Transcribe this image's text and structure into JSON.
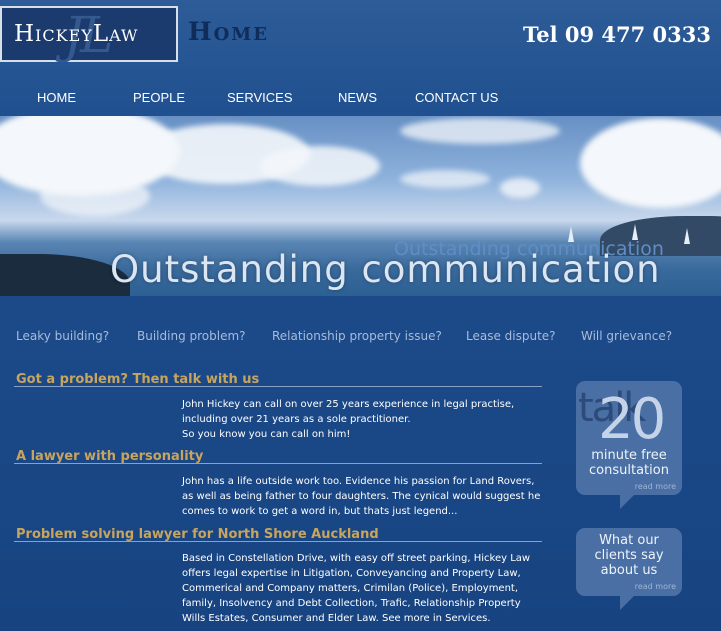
{
  "header": {
    "logo_text": "HickeyLaw",
    "logo_monogram": "JL",
    "page_title": "Home",
    "phone": "Tel 09 477 0333"
  },
  "nav": {
    "items": [
      {
        "label": "HOME"
      },
      {
        "label": "PEOPLE"
      },
      {
        "label": "SERVICES"
      },
      {
        "label": "NEWS"
      },
      {
        "label": "CONTACT US"
      }
    ]
  },
  "hero": {
    "tagline": "Outstanding communication",
    "tagline_echo": "Outstanding communication"
  },
  "topics": [
    {
      "label": "Leaky building?"
    },
    {
      "label": "Building problem?"
    },
    {
      "label": "Relationship property issue?"
    },
    {
      "label": "Lease dispute?"
    },
    {
      "label": "Will grievance?"
    }
  ],
  "sections": [
    {
      "heading": "Got a problem? Then talk with us",
      "paragraphs": [
        "John Hickey can call on over 25 years experience in legal practise, including over 21 years as a sole practitioner.",
        "So you know you can call on him!"
      ]
    },
    {
      "heading": "A lawyer with personality",
      "paragraphs": [
        "John has a life outside work too. Evidence his passion for Land Rovers, as well as being father to four daughters. The cynical would suggest he comes to work to get a word in, but thats just legend..."
      ]
    },
    {
      "heading": "Problem solving lawyer for North Shore Auckland",
      "paragraphs": [
        "Based in Constellation Drive, with easy off street parking, Hickey Law offers legal expertise in Litigation, Conveyancing and Property Law, Commerical and Company matters, Crimilan (Police), Employment, family, Insolvency and Debt Collection, Trafic, Relationship Property Wills Estates, Consumer and Elder Law. See more in Services."
      ]
    }
  ],
  "sidebar": {
    "consult": {
      "bg_word": "talk",
      "number": "20",
      "line1": "minute free",
      "line2": "consultation",
      "read_more": "read more"
    },
    "clients": {
      "line1": "What our",
      "line2": "clients say",
      "line3": "about us",
      "read_more": "read more"
    }
  },
  "colors": {
    "background": "#1e4a8a",
    "heading_gold": "#c8a55e",
    "topic_text": "#a7bcda",
    "card": "#4a6fa4"
  }
}
